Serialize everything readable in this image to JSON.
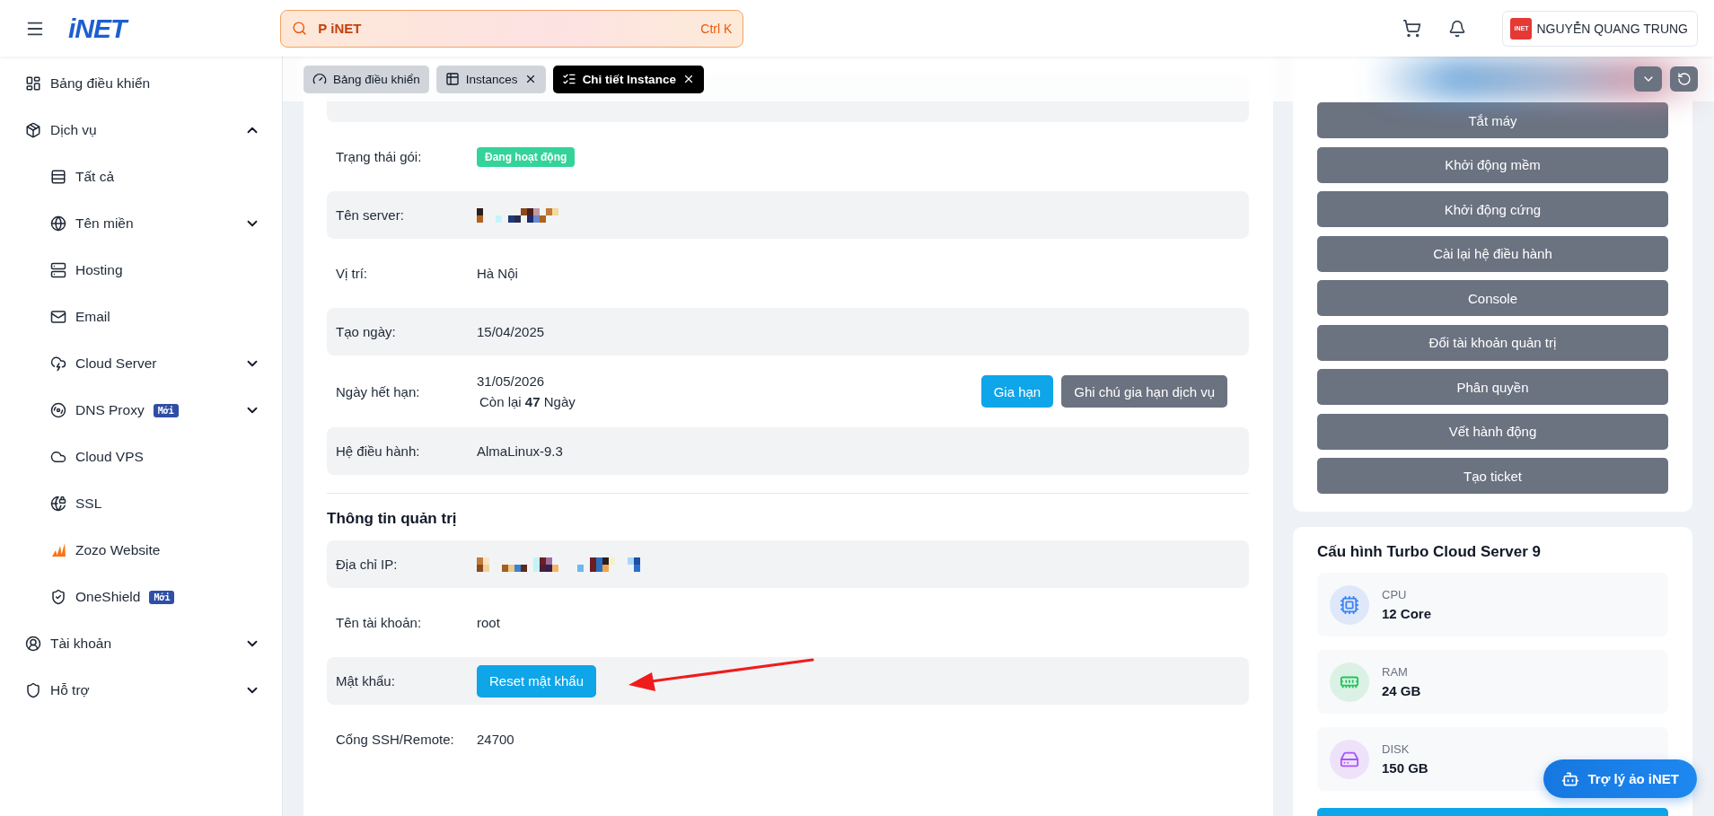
{
  "header": {
    "logo": "iNET",
    "search": {
      "placeholder": "P iNET",
      "shortcut": "Ctrl K"
    },
    "user": {
      "avatar_text": "iNET",
      "name": "NGUYỄN QUANG TRUNG"
    }
  },
  "sidebar": {
    "items": [
      {
        "label": "Bảng điều khiển"
      },
      {
        "label": "Dịch vụ",
        "expanded": true,
        "children": [
          {
            "label": "Tất cả"
          },
          {
            "label": "Tên miền",
            "expanded": false
          },
          {
            "label": "Hosting"
          },
          {
            "label": "Email"
          },
          {
            "label": "Cloud Server",
            "expanded": false
          },
          {
            "label": "DNS Proxy",
            "badge": "Mới",
            "expanded": false
          },
          {
            "label": "Cloud VPS"
          },
          {
            "label": "SSL"
          },
          {
            "label": "Zozo Website"
          },
          {
            "label": "OneShield",
            "badge": "Mới"
          }
        ]
      },
      {
        "label": "Tài khoản",
        "expanded": false
      },
      {
        "label": "Hỗ trợ",
        "expanded": false
      }
    ]
  },
  "tabs": [
    {
      "label": "Bảng điều khiển",
      "selected": false,
      "closable": false
    },
    {
      "label": "Instances",
      "selected": false,
      "closable": true
    },
    {
      "label": "Chi tiết Instance",
      "selected": true,
      "closable": true
    }
  ],
  "details": {
    "rows": [
      {
        "kind": "badge",
        "label": "Trạng thái gói:",
        "value": "Đang hoạt động"
      },
      {
        "kind": "redacted",
        "label": "Tên server:"
      },
      {
        "kind": "text",
        "label": "Vị trí:",
        "value": "Hà Nội"
      },
      {
        "kind": "text",
        "label": "Tạo ngày:",
        "value": "15/04/2025"
      },
      {
        "kind": "expiry",
        "label": "Ngày hết hạn:",
        "value": "31/05/2026",
        "remaining": "Còn lại **47** Ngày",
        "buttons": [
          "Gia hạn",
          "Ghi chú gia hạn dịch vụ"
        ]
      },
      {
        "kind": "text",
        "label": "Hệ điều hành:",
        "value": "AlmaLinux-9.3"
      }
    ]
  },
  "admin": {
    "title": "Thông tin quản trị",
    "rows": [
      {
        "kind": "redacted",
        "label": "Địa chỉ IP:"
      },
      {
        "kind": "text",
        "label": "Tên tài khoản:",
        "value": "root"
      },
      {
        "kind": "button",
        "label": "Mật khẩu:",
        "value": "Reset mật khẩu"
      },
      {
        "kind": "text",
        "label": "Cổng SSH/Remote:",
        "value": "24700"
      }
    ]
  },
  "actions": [
    "Tắt máy",
    "Khởi động mềm",
    "Khởi động cứng",
    "Cài lại hệ điều hành",
    "Console",
    "Đổi tài khoản quản trị",
    "Phân quyền",
    "Vết hành động",
    "Tạo ticket"
  ],
  "config": {
    "title": "Cấu hình Turbo Cloud Server 9",
    "specs": [
      {
        "kind": "cpu",
        "label": "CPU",
        "value": "12 Core",
        "color": "#3b82f6"
      },
      {
        "kind": "ram",
        "label": "RAM",
        "value": "24 GB",
        "color": "#22c55e"
      },
      {
        "kind": "disk",
        "label": "DISK",
        "value": "150 GB",
        "color": "#a855f7"
      }
    ]
  },
  "assistant": {
    "label": "Trợ lý ảo iNET"
  }
}
